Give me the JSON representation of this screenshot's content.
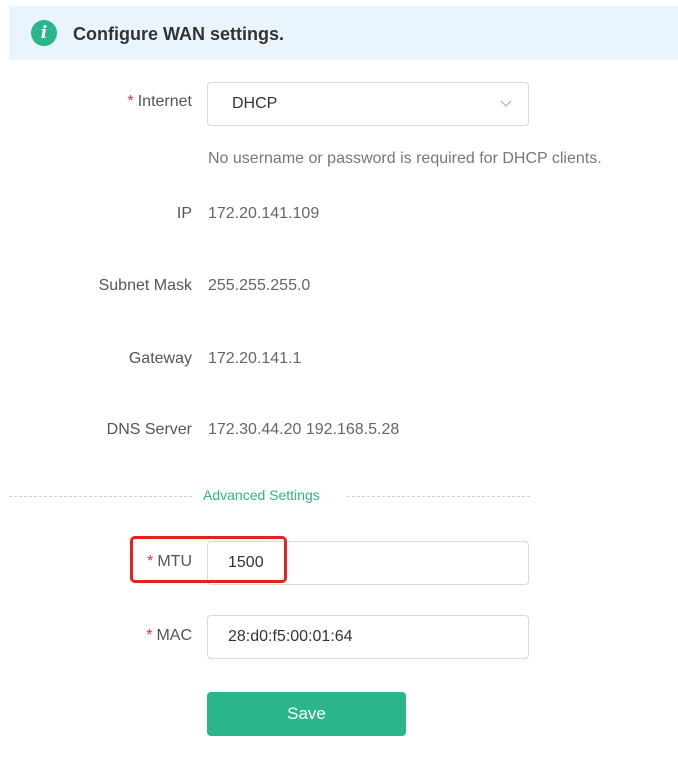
{
  "banner": {
    "icon": "info-icon",
    "text": "Configure WAN settings."
  },
  "internet": {
    "label": "Internet",
    "required_mark": "*",
    "selected": "DHCP",
    "hint": "No username or password is required for DHCP clients."
  },
  "ip": {
    "label": "IP",
    "value": "172.20.141.109"
  },
  "subnet": {
    "label": "Subnet Mask",
    "value": "255.255.255.0"
  },
  "gateway": {
    "label": "Gateway",
    "value": "172.20.141.1"
  },
  "dns": {
    "label": "DNS Server",
    "value": "172.30.44.20 192.168.5.28"
  },
  "advanced": {
    "label": "Advanced Settings"
  },
  "mtu": {
    "label": "MTU",
    "required_mark": "*",
    "value": "1500"
  },
  "mac": {
    "label": "MAC",
    "required_mark": "*",
    "value": "28:d0:f5:00:01:64"
  },
  "save": {
    "label": "Save"
  },
  "colors": {
    "accent": "#2bb58a",
    "banner_bg": "#eaf4fd",
    "required": "#e5343d",
    "highlight": "#e8211d"
  }
}
